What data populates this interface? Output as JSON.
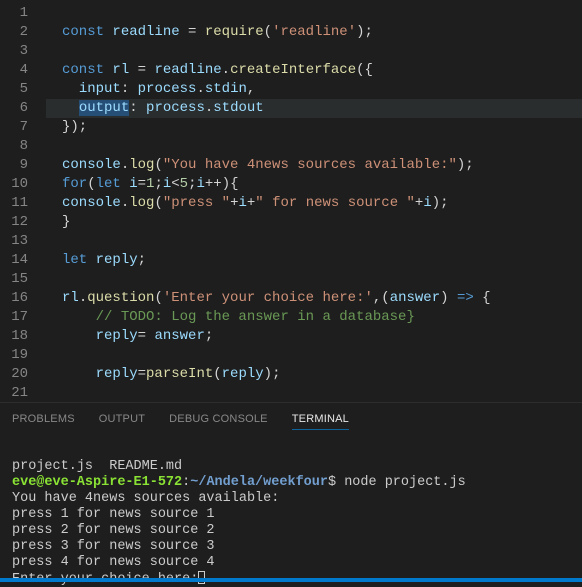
{
  "lineCount": 21,
  "highlightLine": 6,
  "code": [
    [
      {
        "t": "",
        "c": "op"
      }
    ],
    [
      {
        "t": "const ",
        "c": "kw"
      },
      {
        "t": "readline",
        "c": "var"
      },
      {
        "t": " = ",
        "c": "op"
      },
      {
        "t": "require",
        "c": "fn"
      },
      {
        "t": "(",
        "c": "op"
      },
      {
        "t": "'readline'",
        "c": "str"
      },
      {
        "t": ");",
        "c": "op"
      }
    ],
    [
      {
        "t": "",
        "c": "op"
      }
    ],
    [
      {
        "t": "const ",
        "c": "kw"
      },
      {
        "t": "rl",
        "c": "var"
      },
      {
        "t": " = ",
        "c": "op"
      },
      {
        "t": "readline",
        "c": "var"
      },
      {
        "t": ".",
        "c": "op"
      },
      {
        "t": "createInterface",
        "c": "fn"
      },
      {
        "t": "({",
        "c": "op"
      }
    ],
    [
      {
        "t": "  ",
        "c": "op"
      },
      {
        "t": "input",
        "c": "var"
      },
      {
        "t": ": ",
        "c": "op"
      },
      {
        "t": "process",
        "c": "var"
      },
      {
        "t": ".",
        "c": "op"
      },
      {
        "t": "stdin",
        "c": "var"
      },
      {
        "t": ",",
        "c": "op"
      }
    ],
    [
      {
        "t": "  ",
        "c": "op"
      },
      {
        "t": "output",
        "c": "var sel"
      },
      {
        "t": ": ",
        "c": "op"
      },
      {
        "t": "process",
        "c": "var"
      },
      {
        "t": ".",
        "c": "op"
      },
      {
        "t": "stdout",
        "c": "var"
      }
    ],
    [
      {
        "t": "});",
        "c": "op"
      }
    ],
    [
      {
        "t": "",
        "c": "op"
      }
    ],
    [
      {
        "t": "console",
        "c": "var"
      },
      {
        "t": ".",
        "c": "op"
      },
      {
        "t": "log",
        "c": "fn"
      },
      {
        "t": "(",
        "c": "op"
      },
      {
        "t": "\"You have 4news sources available:\"",
        "c": "str"
      },
      {
        "t": ");",
        "c": "op"
      }
    ],
    [
      {
        "t": "for",
        "c": "kw"
      },
      {
        "t": "(",
        "c": "op"
      },
      {
        "t": "let ",
        "c": "kw"
      },
      {
        "t": "i",
        "c": "var"
      },
      {
        "t": "=",
        "c": "op"
      },
      {
        "t": "1",
        "c": "num"
      },
      {
        "t": ";",
        "c": "op"
      },
      {
        "t": "i",
        "c": "var"
      },
      {
        "t": "<",
        "c": "op"
      },
      {
        "t": "5",
        "c": "num"
      },
      {
        "t": ";",
        "c": "op"
      },
      {
        "t": "i",
        "c": "var"
      },
      {
        "t": "++){",
        "c": "op"
      }
    ],
    [
      {
        "t": "console",
        "c": "var"
      },
      {
        "t": ".",
        "c": "op"
      },
      {
        "t": "log",
        "c": "fn"
      },
      {
        "t": "(",
        "c": "op"
      },
      {
        "t": "\"press \"",
        "c": "str"
      },
      {
        "t": "+",
        "c": "op"
      },
      {
        "t": "i",
        "c": "var"
      },
      {
        "t": "+",
        "c": "op"
      },
      {
        "t": "\" for news source \"",
        "c": "str"
      },
      {
        "t": "+",
        "c": "op"
      },
      {
        "t": "i",
        "c": "var"
      },
      {
        "t": ");",
        "c": "op"
      }
    ],
    [
      {
        "t": "}",
        "c": "op"
      }
    ],
    [
      {
        "t": "",
        "c": "op"
      }
    ],
    [
      {
        "t": "let ",
        "c": "kw"
      },
      {
        "t": "reply",
        "c": "var"
      },
      {
        "t": ";",
        "c": "op"
      }
    ],
    [
      {
        "t": "",
        "c": "op"
      }
    ],
    [
      {
        "t": "rl",
        "c": "var"
      },
      {
        "t": ".",
        "c": "op"
      },
      {
        "t": "question",
        "c": "fn"
      },
      {
        "t": "(",
        "c": "op"
      },
      {
        "t": "'Enter your choice here:'",
        "c": "str"
      },
      {
        "t": ",(",
        "c": "op"
      },
      {
        "t": "answer",
        "c": "var"
      },
      {
        "t": ") ",
        "c": "op"
      },
      {
        "t": "=>",
        "c": "kw"
      },
      {
        "t": " {",
        "c": "op"
      }
    ],
    [
      {
        "t": "    ",
        "c": "op"
      },
      {
        "t": "// TODO: Log the answer in a database}",
        "c": "cmt"
      }
    ],
    [
      {
        "t": "    ",
        "c": "op"
      },
      {
        "t": "reply",
        "c": "var"
      },
      {
        "t": "= ",
        "c": "op"
      },
      {
        "t": "answer",
        "c": "var"
      },
      {
        "t": ";",
        "c": "op"
      }
    ],
    [
      {
        "t": "",
        "c": "op"
      }
    ],
    [
      {
        "t": "    ",
        "c": "op"
      },
      {
        "t": "reply",
        "c": "var"
      },
      {
        "t": "=",
        "c": "op"
      },
      {
        "t": "parseInt",
        "c": "fn"
      },
      {
        "t": "(",
        "c": "op"
      },
      {
        "t": "reply",
        "c": "var"
      },
      {
        "t": ");",
        "c": "op"
      }
    ],
    [
      {
        "t": "",
        "c": "op"
      }
    ]
  ],
  "panelTabs": {
    "problems": "PROBLEMS",
    "output": "OUTPUT",
    "debug": "DEBUG CONSOLE",
    "terminal": "TERMINAL"
  },
  "terminal": {
    "files": "project.js  README.md",
    "user": "eve@eve-Aspire-E1-572",
    "colon": ":",
    "path": "~/Andela/weekfour",
    "prompt": "$ ",
    "command": "node project.js",
    "out1": "You have 4news sources available:",
    "out2": "press 1 for news source 1",
    "out3": "press 2 for news source 2",
    "out4": "press 3 for news source 3",
    "out5": "press 4 for news source 4",
    "out6": "Enter your choice here:"
  }
}
